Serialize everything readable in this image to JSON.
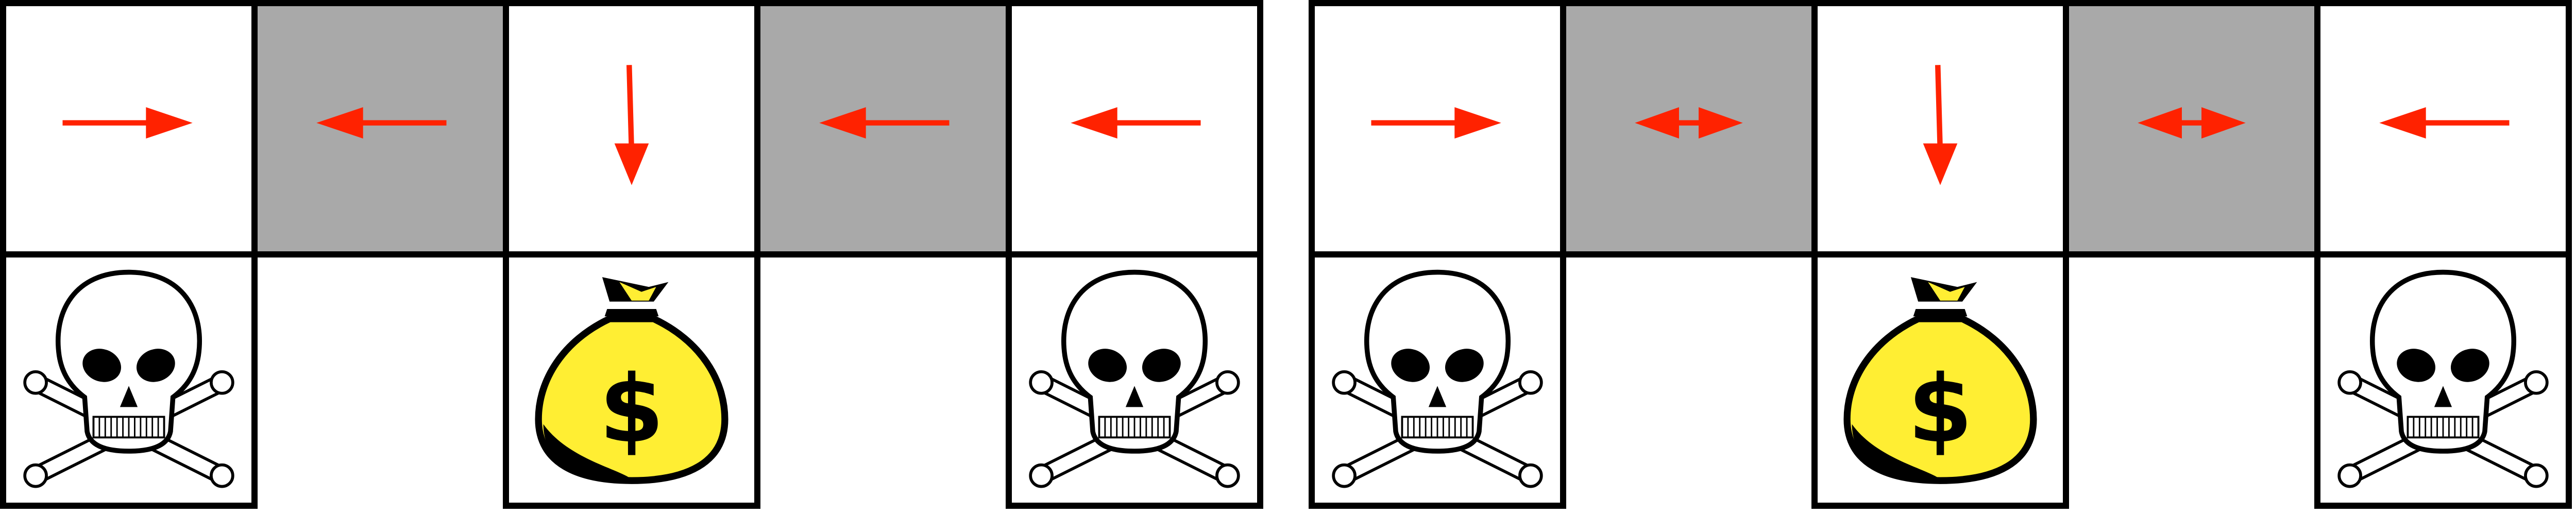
{
  "colors": {
    "arrow": "#ff2200",
    "shaded_cell": "#a9a9a9",
    "grid_line": "#000000",
    "bag_fill": "#ffee33"
  },
  "panels": [
    {
      "top_row": [
        "right",
        "left",
        "down",
        "left",
        "left"
      ],
      "shaded": [
        false,
        true,
        false,
        true,
        false
      ],
      "bottom_row": [
        "skull-crossbones",
        null,
        "money-bag",
        null,
        "skull-crossbones"
      ]
    },
    {
      "top_row": [
        "right",
        "left-right",
        "down",
        "left-right",
        "left"
      ],
      "shaded": [
        false,
        true,
        false,
        true,
        false
      ],
      "bottom_row": [
        "skull-crossbones",
        null,
        "money-bag",
        null,
        "skull-crossbones"
      ]
    }
  ],
  "money_bag_symbol": "$"
}
